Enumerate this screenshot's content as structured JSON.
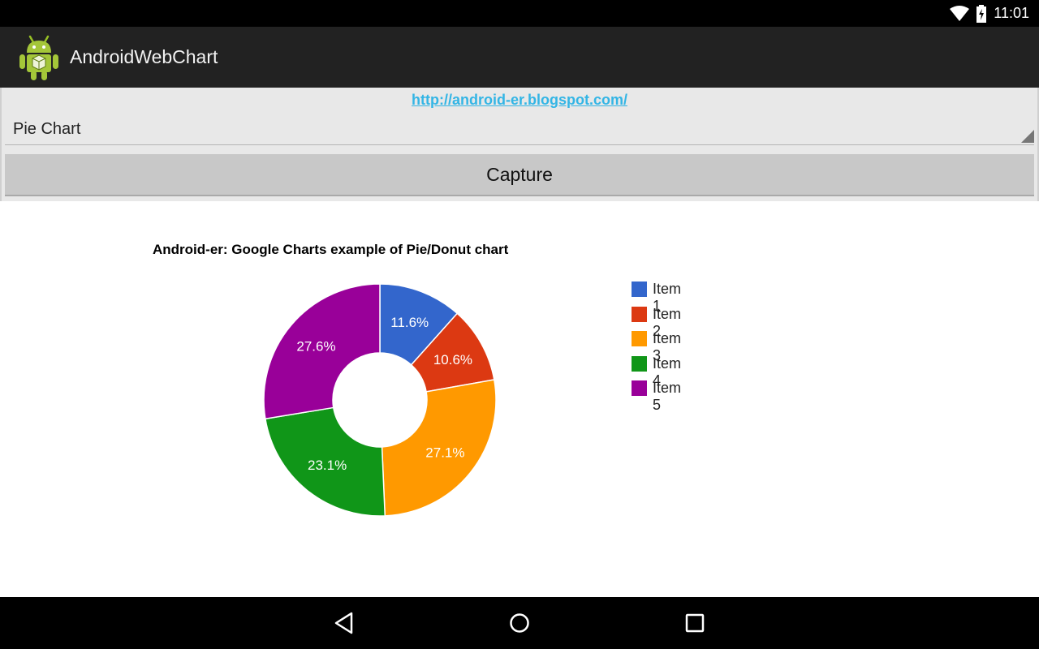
{
  "status_bar": {
    "time": "11:01",
    "icons": [
      "wifi-icon",
      "battery-charging-icon"
    ]
  },
  "action_bar": {
    "app_icon": "android-robot-icon",
    "title": "AndroidWebChart"
  },
  "controls": {
    "link_text": "http://android-er.blogspot.com/",
    "spinner_value": "Pie Chart",
    "capture_label": "Capture"
  },
  "chart_data": {
    "type": "pie",
    "donut": true,
    "title": "Android-er: Google Charts example of Pie/Donut chart",
    "legend_position": "right",
    "categories": [
      "Item 1",
      "Item 2",
      "Item 3",
      "Item 4",
      "Item 5"
    ],
    "values": [
      11.6,
      10.6,
      27.1,
      23.1,
      27.6
    ],
    "labels": [
      "11.6%",
      "10.6%",
      "27.1%",
      "23.1%",
      "27.6%"
    ],
    "colors": [
      "#3366cc",
      "#dc3912",
      "#ff9900",
      "#109618",
      "#990099"
    ]
  },
  "nav_bar": {
    "icons": [
      "back-icon",
      "home-icon",
      "recents-icon"
    ]
  }
}
